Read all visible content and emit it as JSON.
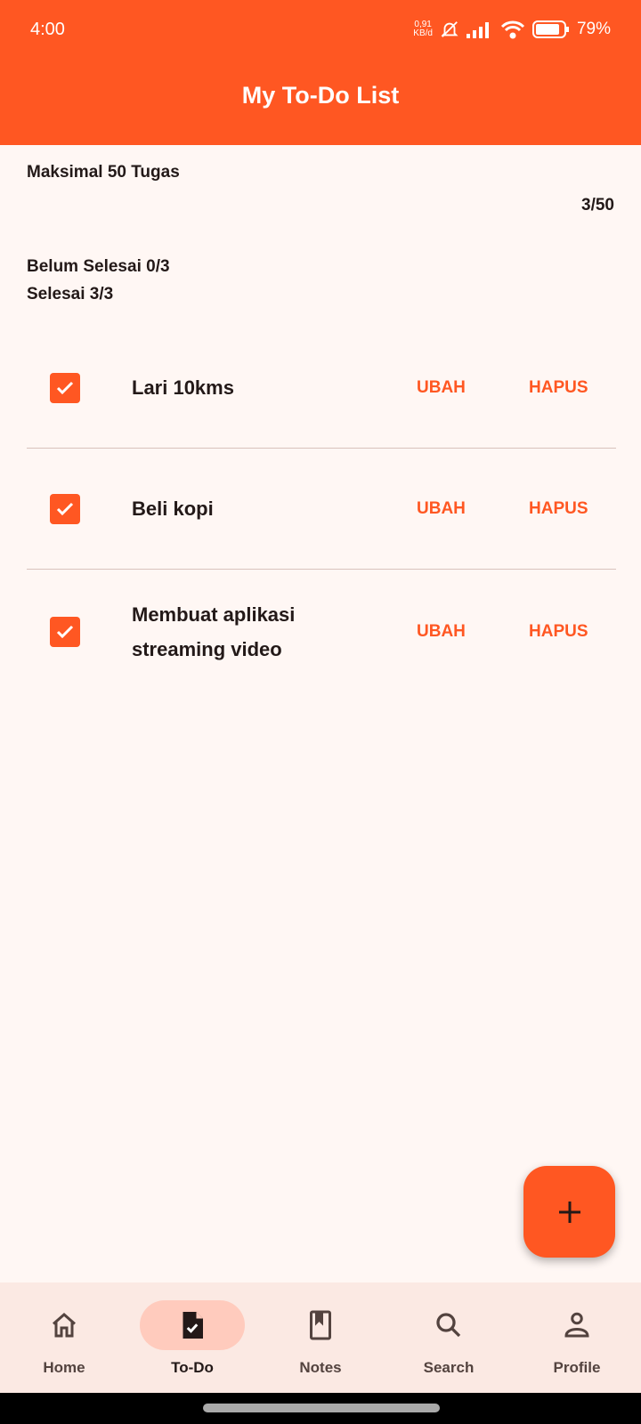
{
  "status": {
    "time": "4:00",
    "speed_top": "0,91",
    "speed_bottom": "KB/d",
    "battery": "79%"
  },
  "header": {
    "title": "My To-Do List"
  },
  "summary": {
    "max": "Maksimal 50 Tugas",
    "count": "3/50",
    "pending": "Belum Selesai 0/3",
    "done": "Selesai 3/3"
  },
  "tasks": [
    {
      "label": "Lari 10kms",
      "checked": true,
      "edit": "UBAH",
      "delete": "HAPUS"
    },
    {
      "label": "Beli kopi",
      "checked": true,
      "edit": "UBAH",
      "delete": "HAPUS"
    },
    {
      "label": "Membuat aplikasi streaming video",
      "checked": true,
      "edit": "UBAH",
      "delete": "HAPUS"
    }
  ],
  "nav": [
    {
      "label": "Home"
    },
    {
      "label": "To-Do"
    },
    {
      "label": "Notes"
    },
    {
      "label": "Search"
    },
    {
      "label": "Profile"
    }
  ],
  "colors": {
    "accent": "#ff5722",
    "background": "#fff7f4",
    "nav": "#fbe9e3"
  }
}
